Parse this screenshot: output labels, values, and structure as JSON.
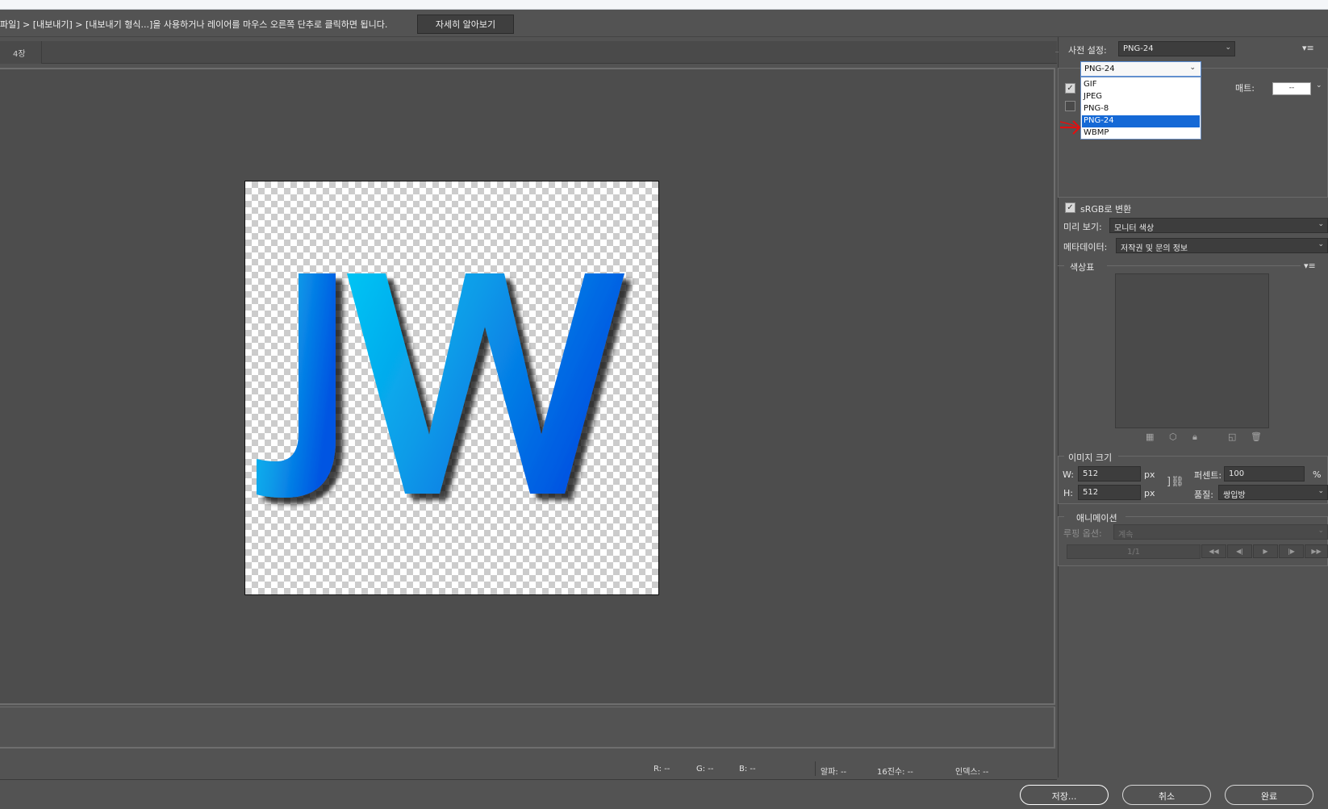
{
  "info_bar": {
    "text": "파일] > [내보내기] > [내보내기 형식...]을 사용하거나 레이어를 마우스 오른쪽 단추로 클릭하면 됩니다.",
    "learn_more_label": "자세히 알아보기"
  },
  "view_tab": {
    "label": "4장"
  },
  "preview": {
    "letters": "JW"
  },
  "status": {
    "r": "R: --",
    "g": "G: --",
    "b": "B: --",
    "alpha": "알파: --",
    "hex": "16진수: --",
    "index": "인덱스: --"
  },
  "buttons": {
    "save": "저장...",
    "cancel": "취소",
    "done": "완료"
  },
  "preset": {
    "label": "사전 설정:",
    "value": "PNG-24"
  },
  "format": {
    "value": "PNG-24",
    "options": [
      "GIF",
      "JPEG",
      "PNG-8",
      "PNG-24",
      "WBMP"
    ],
    "selected": "PNG-24"
  },
  "matte": {
    "label": "매트:",
    "value": "--"
  },
  "convert_srgb": {
    "label": "sRGB로 변환",
    "checked": true
  },
  "preview_mode": {
    "label": "미리 보기:",
    "value": "모니터 색상"
  },
  "metadata": {
    "label": "메타데이터:",
    "value": "저작권 및 문의 정보"
  },
  "color_table": {
    "label": "색상표"
  },
  "image_size": {
    "label": "이미지 크기",
    "w_label": "W:",
    "w_value": "512",
    "w_unit": "px",
    "h_label": "H:",
    "h_value": "512",
    "h_unit": "px",
    "percent_label": "퍼센트:",
    "percent_value": "100",
    "percent_unit": "%",
    "quality_label": "품질:",
    "quality_value": "쌍입방"
  },
  "animation": {
    "label": "애니메이션",
    "loop_label": "루핑 옵션:",
    "loop_value": "계속",
    "frame_counter": "1/1"
  },
  "colors": {
    "letter_start": "#00c4f4",
    "letter_end": "#0055e2",
    "dropdown_highlight": "#1569d6",
    "annotation_arrow": "#e01010"
  }
}
